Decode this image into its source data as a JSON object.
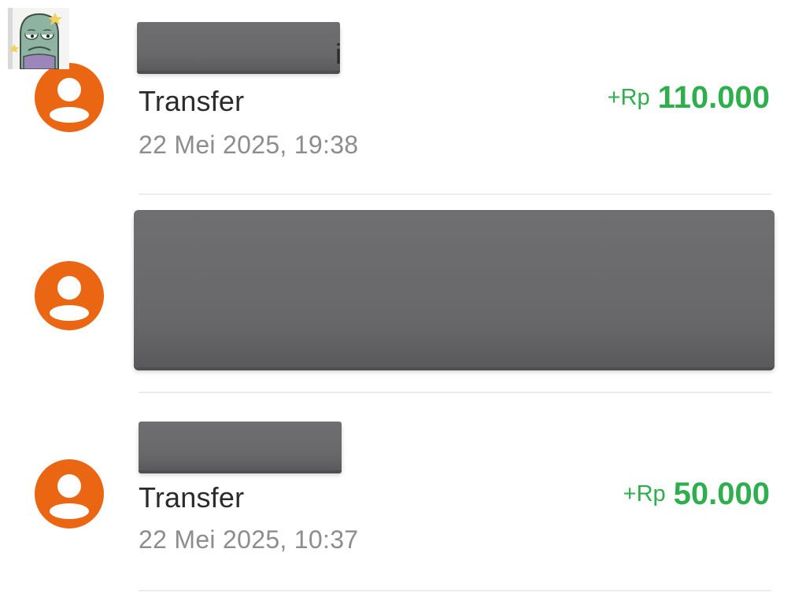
{
  "transactions": [
    {
      "type": "Transfer",
      "date": "22 Mei 2025, 19:38",
      "currency": "+Rp",
      "amount": "110.000",
      "name_tail": "i",
      "name_redacted": true
    },
    {
      "name_redacted": true
    },
    {
      "type": "Transfer",
      "date": "22 Mei 2025, 10:37",
      "currency": "+Rp",
      "amount": "50.000",
      "name_redacted": true
    }
  ],
  "icons": {
    "avatar": "user-avatar-icon",
    "sticker": "cartoon-sticker-icon"
  },
  "colors": {
    "avatar": "#ea6612",
    "amount": "#2fae4d",
    "type_text": "#2b2b2b",
    "date_text": "#8d8d8d",
    "redaction": "#6c6c6e",
    "divider": "#ececec"
  }
}
